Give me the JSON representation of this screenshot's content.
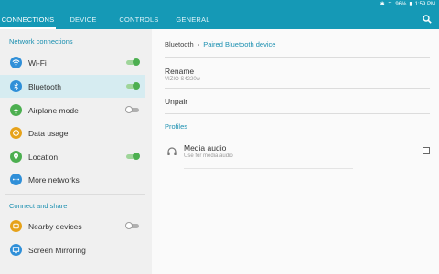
{
  "status_bar": {
    "battery": "96%",
    "time": "1:59 PM"
  },
  "tabs": [
    {
      "label": "CONNECTIONS",
      "active": true
    },
    {
      "label": "DEVICE",
      "active": false
    },
    {
      "label": "CONTROLS",
      "active": false
    },
    {
      "label": "GENERAL",
      "active": false
    }
  ],
  "left": {
    "section1": "Network connections",
    "section2": "Connect and share",
    "items": [
      {
        "label": "Wi-Fi",
        "icon": "wifi-icon",
        "color": "#2f8fd8",
        "toggle": "on"
      },
      {
        "label": "Bluetooth",
        "icon": "bluetooth-icon",
        "color": "#2f8fd8",
        "toggle": "on"
      },
      {
        "label": "Airplane mode",
        "icon": "airplane-icon",
        "color": "#4caf50",
        "toggle": "off"
      },
      {
        "label": "Data usage",
        "icon": "data-usage-icon",
        "color": "#e6a21a",
        "toggle": null
      },
      {
        "label": "Location",
        "icon": "location-icon",
        "color": "#4caf50",
        "toggle": "on"
      },
      {
        "label": "More networks",
        "icon": "more-networks-icon",
        "color": "#2f8fd8",
        "toggle": null
      },
      {
        "label": "Nearby devices",
        "icon": "nearby-devices-icon",
        "color": "#e6a21a",
        "toggle": "off"
      },
      {
        "label": "Screen Mirroring",
        "icon": "screen-mirroring-icon",
        "color": "#2f8fd8",
        "toggle": null
      }
    ]
  },
  "right": {
    "breadcrumb_parent": "Bluetooth",
    "breadcrumb_sep": "›",
    "breadcrumb_current": "Paired Bluetooth device",
    "rename_label": "Rename",
    "device_name": "VIZIO S4220w",
    "unpair_label": "Unpair",
    "profiles_header": "Profiles",
    "media_title": "Media audio",
    "media_sub": "Use for media audio"
  },
  "colors": {
    "accent": "#1599b6",
    "highlight": "#d6ecf1",
    "toggle_on": "#4caf50"
  }
}
